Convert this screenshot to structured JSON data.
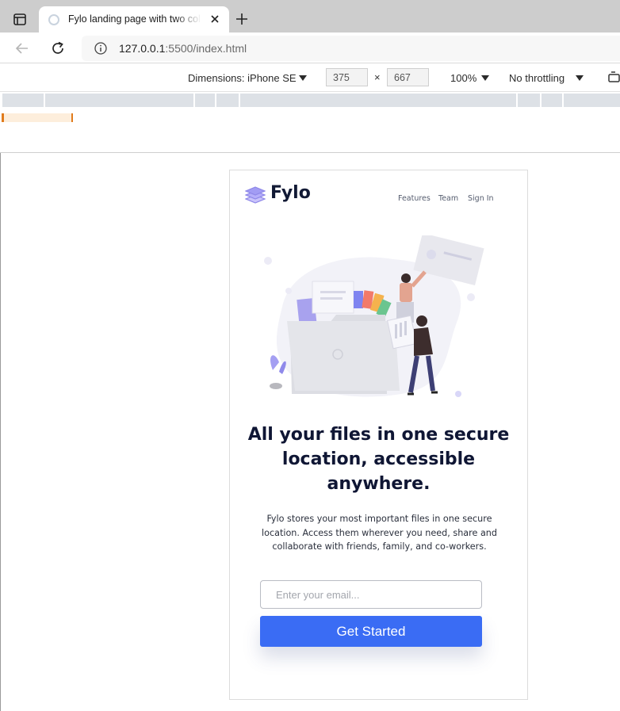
{
  "browser": {
    "tab_title": "Fylo landing page with two columns",
    "url_host": "127.0.0.1",
    "url_rest": ":5500/index.html",
    "icons": [
      "tab-actions-icon",
      "globe-icon",
      "close-icon",
      "plus-icon",
      "back-arrow-icon",
      "reload-icon",
      "info-icon"
    ]
  },
  "devtools": {
    "dimensions_label": "Dimensions: iPhone SE",
    "width": "375",
    "height": "667",
    "times": "×",
    "zoom": "100%",
    "throttling": "No throttling"
  },
  "page": {
    "brand": "Fylo",
    "nav": [
      "Features",
      "Team",
      "Sign In"
    ],
    "headline": "All your files in one secure location, accessible anywhere.",
    "subtext": "Fylo stores your most important files in one secure location. Access them wherever you need, share and collaborate with friends, family, and co-workers.",
    "email_placeholder": "Enter your email...",
    "cta_label": "Get Started",
    "colors": {
      "accent": "#3a6cf4",
      "heading": "#0f1634",
      "logo": "#a29cf4"
    }
  }
}
